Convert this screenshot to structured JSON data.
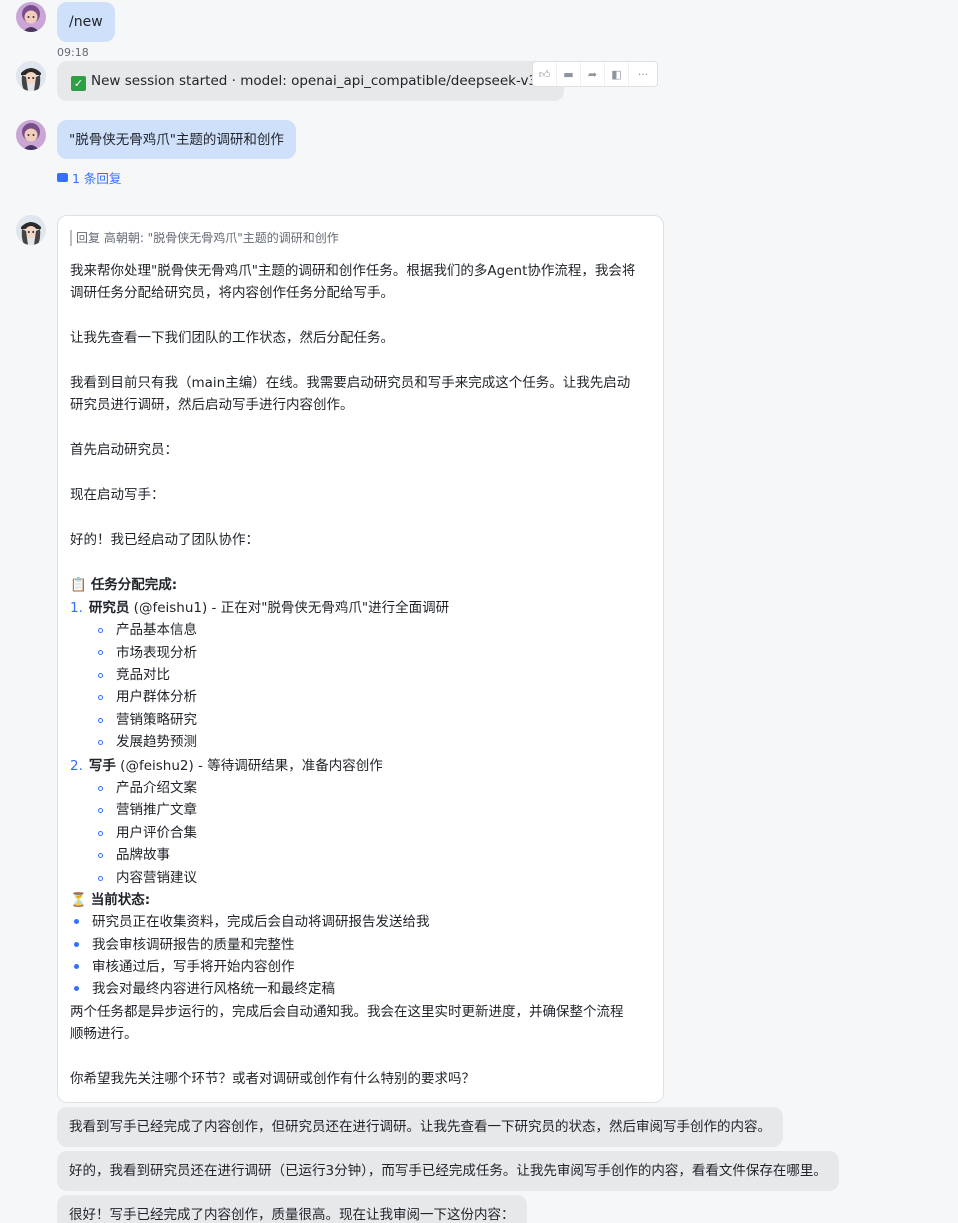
{
  "messages": {
    "m1": {
      "text": "/new",
      "time": "09:18"
    },
    "m2": {
      "text": "New session started · model: openai_api_compatible/deepseek-v3.2"
    },
    "m3": {
      "text": "\"脱骨侠无骨鸡爪\"主题的调研和创作",
      "reply_count": "1 条回复"
    }
  },
  "actions": [
    "thumbs-up-icon",
    "comment-icon",
    "forward-icon",
    "recall-icon",
    "more-icon"
  ],
  "card": {
    "quote": "回复 高朝朝: \"脱骨侠无骨鸡爪\"主题的调研和创作",
    "p1a": "我来帮你处理\"脱骨侠无骨鸡爪\"主题的调研和创作任务。根据我们的多Agent协作流程，我会将",
    "p1b": "调研任务分配给研究员，将内容创作任务分配给写手。",
    "p2": "让我先查看一下我们团队的工作状态，然后分配任务。",
    "p3a": "我看到目前只有我（main主编）在线。我需要启动研究员和写手来完成这个任务。让我先启动",
    "p3b": "研究员进行调研，然后启动写手进行内容创作。",
    "p4": "首先启动研究员：",
    "p5": "现在启动写手：",
    "p6": "好的！我已经启动了团队协作：",
    "assign_title": "任务分配完成:",
    "r_label": "研究员",
    "r_rest": " (@feishu1) - 正在对\"脱骨侠无骨鸡爪\"进行全面调研",
    "r_items": [
      "产品基本信息",
      "市场表现分析",
      "竞品对比",
      "用户群体分析",
      "营销策略研究",
      "发展趋势预测"
    ],
    "w_label": "写手",
    "w_rest": " (@feishu2) - 等待调研结果，准备内容创作",
    "w_items": [
      "产品介绍文案",
      "营销推广文章",
      "用户评价合集",
      "品牌故事",
      "内容营销建议"
    ],
    "status_title": "当前状态:",
    "status_items": [
      "研究员正在收集资料，完成后会自动将调研报告发送给我",
      "我会审核调研报告的质量和完整性",
      "审核通过后，写手将开始内容创作",
      "我会对最终内容进行风格统一和最终定稿"
    ],
    "p7a": "两个任务都是异步运行的，完成后会自动通知我。我会在这里实时更新进度，并确保整个流程",
    "p7b": "顺畅进行。",
    "p8": "你希望我先关注哪个环节？或者对调研或创作有什么特别的要求吗？"
  },
  "followups": [
    "我看到写手已经完成了内容创作，但研究员还在进行调研。让我先查看一下研究员的状态，然后审阅写手创作的内容。",
    "好的，我看到研究员还在进行调研（已运行3分钟），而写手已经完成任务。让我先审阅写手创作的内容，看看文件保存在哪里。",
    "很好！写手已经完成了内容创作，质量很高。现在让我审阅一下这份内容："
  ]
}
